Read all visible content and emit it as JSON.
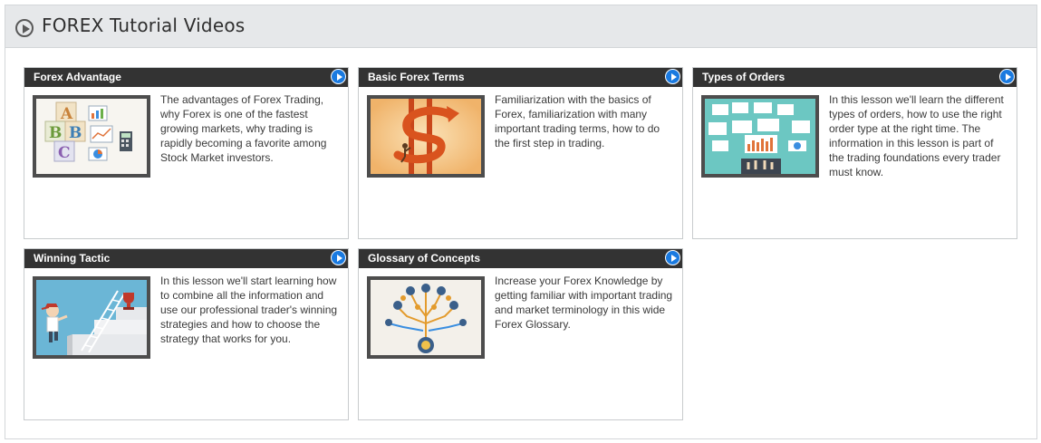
{
  "header": {
    "title": "FOREX Tutorial Videos",
    "icon": "play-circle-icon"
  },
  "cards": [
    {
      "title": "Forex Advantage",
      "description": "The advantages of Forex Trading, why Forex is one of the fastest growing markets, why trading is rapidly becoming a favorite among Stock Market investors.",
      "thumb": "abc-blocks-thumbnail"
    },
    {
      "title": "Basic Forex Terms",
      "description": "Familiarization with the basics of Forex, familiarization with many important trading terms, how to do the first step in trading.",
      "thumb": "dollar-sign-thumbnail"
    },
    {
      "title": "Types of Orders",
      "description": "In this lesson we'll learn the different types of orders, how to use the right order type at the right time. The information in this lesson is part of the trading foundations every trader must know.",
      "thumb": "trading-charts-thumbnail"
    },
    {
      "title": "Winning Tactic",
      "description": "In this lesson we'll start learning how to combine all the information and use our professional trader's winning strategies and how to choose the strategy that works for you.",
      "thumb": "trophy-climb-thumbnail"
    },
    {
      "title": "Glossary of Concepts",
      "description": "Increase your Forex Knowledge by getting familiar with important trading and market terminology in this wide Forex Glossary.",
      "thumb": "knowledge-tree-thumbnail"
    }
  ],
  "colors": {
    "header_bg": "#e6e8ea",
    "card_head_bg": "#333333",
    "play_blue": "#1a7ae0"
  }
}
